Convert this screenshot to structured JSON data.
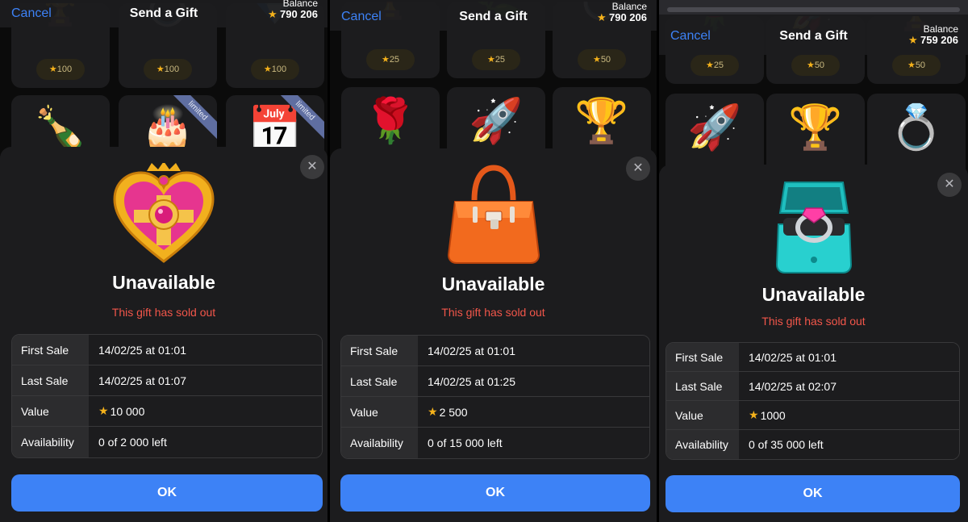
{
  "panels": [
    {
      "cancel": "Cancel",
      "title": "Send a Gift",
      "balance_label": "Balance",
      "balance": "790 206",
      "tiles": [
        {
          "price": "100",
          "emoji": "🏆"
        },
        {
          "price": "100",
          "emoji": "💍"
        },
        {
          "price": "100",
          "emoji": "💎"
        },
        {
          "emoji": "🍾"
        },
        {
          "emoji": "🎂",
          "ribbon": "limited"
        },
        {
          "emoji": "📅",
          "ribbon": "limited"
        }
      ],
      "sheet": {
        "gift_icon": "heart-brooch-icon",
        "title": "Unavailable",
        "subtitle": "This gift has sold out",
        "rows": [
          {
            "key": "First Sale",
            "value": "14/02/25 at 01:01"
          },
          {
            "key": "Last Sale",
            "value": "14/02/25 at 01:07"
          },
          {
            "key": "Value",
            "value": "10 000"
          },
          {
            "key": "Availability",
            "value": "0 of 2 000 left"
          }
        ],
        "ok": "OK"
      }
    },
    {
      "cancel": "Cancel",
      "title": "Send a Gift",
      "balance_label": "Balance",
      "balance": "790 206",
      "tiles": [
        {
          "price": "25",
          "emoji": "🏆"
        },
        {
          "price": "25",
          "emoji": "🌿"
        },
        {
          "price": "50",
          "emoji": "💍"
        },
        {
          "emoji": "🌹"
        },
        {
          "emoji": "🚀"
        },
        {
          "emoji": "🏆"
        }
      ],
      "sheet": {
        "gift_icon": "orange-handbag-icon",
        "title": "Unavailable",
        "subtitle": "This gift has sold out",
        "rows": [
          {
            "key": "First Sale",
            "value": "14/02/25 at 01:01"
          },
          {
            "key": "Last Sale",
            "value": "14/02/25 at 01:25"
          },
          {
            "key": "Value",
            "value": "2 500"
          },
          {
            "key": "Availability",
            "value": "0 of 15 000 left"
          }
        ],
        "ok": "OK"
      }
    },
    {
      "cancel": "Cancel",
      "title": "Send a Gift",
      "balance_label": "Balance",
      "balance": "759 206",
      "tiles": [
        {
          "price": "25",
          "emoji": "🌹"
        },
        {
          "price": "50",
          "emoji": "🚀"
        },
        {
          "price": "50",
          "emoji": "🏆"
        },
        {
          "emoji": "🚀"
        },
        {
          "emoji": "🏆"
        },
        {
          "emoji": "💍"
        }
      ],
      "sheet": {
        "gift_icon": "ring-box-icon",
        "title": "Unavailable",
        "subtitle": "This gift has sold out",
        "rows": [
          {
            "key": "First Sale",
            "value": "14/02/25 at 01:01"
          },
          {
            "key": "Last Sale",
            "value": "14/02/25 at 02:07"
          },
          {
            "key": "Value",
            "value": "1000"
          },
          {
            "key": "Availability",
            "value": "0 of 35 000 left"
          }
        ],
        "ok": "OK"
      }
    }
  ],
  "icons": {
    "star": "★",
    "close": "✕"
  },
  "colors": {
    "accent": "#3d82f6",
    "sold_out": "#f2564a",
    "star": "#f5b21b"
  }
}
